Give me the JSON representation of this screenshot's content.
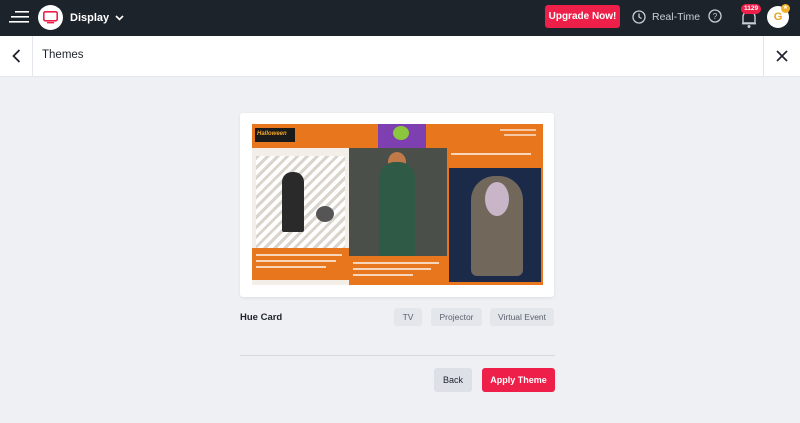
{
  "app": {
    "name": "Display",
    "logo_icon": "tv-icon",
    "accent_color": "#ee2049",
    "topbar_color": "#1d232b"
  },
  "topbar": {
    "upgrade_label": "Upgrade Now!",
    "realtime_label": "Real-Time",
    "notification_count": "1129",
    "avatar_initial": "G"
  },
  "header": {
    "title": "Themes"
  },
  "theme": {
    "name": "Hue Card",
    "preview_logo_text": "Halloween",
    "tags": [
      "TV",
      "Projector",
      "Virtual Event"
    ]
  },
  "actions": {
    "back_label": "Back",
    "apply_label": "Apply Theme"
  }
}
